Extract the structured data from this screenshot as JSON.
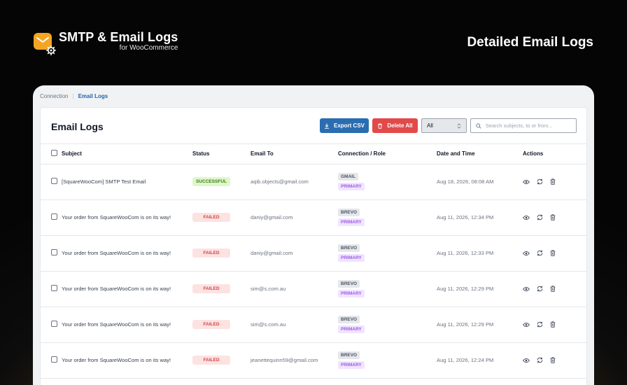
{
  "brand": {
    "title": "SMTP & Email Logs",
    "subtitle": "for WooCommerce"
  },
  "hero_title": "Detailed Email Logs",
  "breadcrumb": {
    "parent": "Connection",
    "current": "Email Logs"
  },
  "card": {
    "title": "Email Logs",
    "export_label": "Export CSV",
    "delete_label": "Delete All",
    "filter_value": "All",
    "search_placeholder": "Search subjects, to or from..."
  },
  "columns": [
    "Subject",
    "Status",
    "Email To",
    "Connection / Role",
    "Date and Time",
    "Actions"
  ],
  "rows": [
    {
      "subject": "[SquareWooCom] SMTP Test Email",
      "status": "SUCCESSFUL",
      "status_type": "success",
      "email": "aqib.objects@gmail.com",
      "connection": "GMAIL",
      "role": "PRIMARY",
      "date": "Aug 18, 2026, 08:08 AM"
    },
    {
      "subject": "Your order from SquareWooCom is on its way!",
      "status": "FAILED",
      "status_type": "failed",
      "email": "daniy@gmail.com",
      "connection": "BREVO",
      "role": "PRIMARY",
      "date": "Aug 11, 2026, 12:34 PM"
    },
    {
      "subject": "Your order from SquareWooCom is on its way!",
      "status": "FAILED",
      "status_type": "failed",
      "email": "daniy@gmail.com",
      "connection": "BREVO",
      "role": "PRIMARY",
      "date": "Aug 11, 2026, 12:33 PM"
    },
    {
      "subject": "Your order from SquareWooCom is on its way!",
      "status": "FAILED",
      "status_type": "failed",
      "email": "sim@s.com.au",
      "connection": "BREVO",
      "role": "PRIMARY",
      "date": "Aug 11, 2026, 12:29 PM"
    },
    {
      "subject": "Your order from SquareWooCom is on its way!",
      "status": "FAILED",
      "status_type": "failed",
      "email": "sim@s.com.au",
      "connection": "BREVO",
      "role": "PRIMARY",
      "date": "Aug 11, 2026, 12:29 PM"
    },
    {
      "subject": "Your order from SquareWooCom is on its way!",
      "status": "FAILED",
      "status_type": "failed",
      "email": "jeanettequinn59@gmail.com",
      "connection": "BREVO",
      "role": "PRIMARY",
      "date": "Aug 11, 2026, 12:24 PM"
    }
  ],
  "icons": {
    "logo": "envelope-gear-icon",
    "export": "download-icon",
    "delete": "trash-icon",
    "search": "search-icon",
    "view": "eye-icon",
    "resend": "refresh-icon",
    "remove": "trash-icon"
  },
  "colors": {
    "accent": "#2a6db0",
    "danger": "#e24a4a",
    "brand": "#f5a524",
    "success": "#3f7d1e",
    "role": "#9b5de5"
  }
}
